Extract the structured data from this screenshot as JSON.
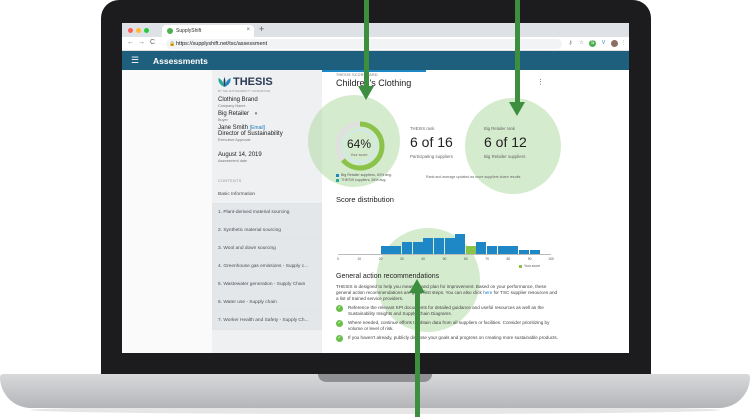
{
  "browser": {
    "tab_title": "SupplyShift",
    "tab_close": "×",
    "new_tab": "+",
    "url": "https://supplyshift.net/tsc/assessment",
    "back": "←",
    "forward": "→",
    "reload": "C"
  },
  "app": {
    "title": "Assessments",
    "menu_icon": "hamburger-icon"
  },
  "sidebar": {
    "logo_text": "THESIS",
    "logo_subtitle": "BY THE SUSTAINABILITY CONSORTIUM",
    "company_name": "Clothing Brand",
    "company_label": "Company Name",
    "buyer_name": "Big Retailer",
    "buyer_label": "Buyer",
    "approver_name": "Jane Smith",
    "approver_email": "[Email]",
    "approver_title": "Director of Sustainability",
    "approver_label": "Executive Approval",
    "date": "August 14, 2019",
    "date_label": "Assessment date",
    "contents_label": "CONTENTS",
    "items": [
      {
        "label": "Basic Information"
      },
      {
        "label": "1. Plant-derived material sourcing"
      },
      {
        "label": "2. Synthetic material sourcing"
      },
      {
        "label": "3. Wool and down sourcing"
      },
      {
        "label": "4. Greenhouse gas emissions - Supply c..."
      },
      {
        "label": "5. Wastewater generation - Supply Chain"
      },
      {
        "label": "6. Water use - Supply chain"
      },
      {
        "label": "7. Worker Health and Safety - Supply Ch..."
      }
    ]
  },
  "scorecard": {
    "label": "THESIS SCORECARD",
    "title": "Children's Clothing",
    "score": "64%",
    "score_fraction": 0.64,
    "score_caption": "Your score",
    "thesis_rank_label": "THESIS rank",
    "thesis_rank": "6 of 16",
    "thesis_rank_caption": "Participating suppliers",
    "retailer_rank_label": "Big Retailer rank",
    "retailer_rank": "6 of 12",
    "retailer_rank_caption": "Big Retailer suppliers",
    "legend_1": "Big Retailer suppliers, 63% avg.",
    "legend_2": "THESIS suppliers, 58% avg.",
    "rank_note": "Rank and average updated as more suppliers share results.",
    "colors": {
      "retailer": "#1e88c7",
      "thesis": "#26a69a",
      "yours": "#8bc34a"
    }
  },
  "chart_data": {
    "type": "bar",
    "title": "Score distribution",
    "x_ticks": [
      "0",
      "10",
      "20",
      "30",
      "40",
      "50",
      "60",
      "70",
      "80",
      "90",
      "100"
    ],
    "xlim": [
      0,
      100
    ],
    "bins": [
      {
        "x": 20,
        "count": 2
      },
      {
        "x": 25,
        "count": 2
      },
      {
        "x": 30,
        "count": 3
      },
      {
        "x": 35,
        "count": 3
      },
      {
        "x": 40,
        "count": 4
      },
      {
        "x": 45,
        "count": 4
      },
      {
        "x": 50,
        "count": 4
      },
      {
        "x": 55,
        "count": 5
      },
      {
        "x": 60,
        "count": 2,
        "yours": true
      },
      {
        "x": 65,
        "count": 3
      },
      {
        "x": 70,
        "count": 2
      },
      {
        "x": 75,
        "count": 2
      },
      {
        "x": 80,
        "count": 2
      },
      {
        "x": 85,
        "count": 1
      },
      {
        "x": 90,
        "count": 1
      }
    ],
    "legend": "Your score"
  },
  "recommendations": {
    "title": "General action recommendations",
    "intro_1": "THESIS is designed to help you measure and plan for improvement. Based on your performance, these general action recommendations are good first steps. You can also click",
    "intro_link": "here",
    "intro_2": "for TSC supplier resources and a list of trained service providers.",
    "items": [
      {
        "text": "Reference the relevant KPI documents for detailed guidance and useful resources as well as the Sustainability Insights and Supply Chain Diagrams."
      },
      {
        "text": "Where needed, continue efforts to obtain data from all suppliers or facilities. Consider prioritizing by volume or level of risk."
      },
      {
        "text": "If you haven't already, publicly disclose your goals and progress on creating more sustainable products."
      }
    ]
  }
}
